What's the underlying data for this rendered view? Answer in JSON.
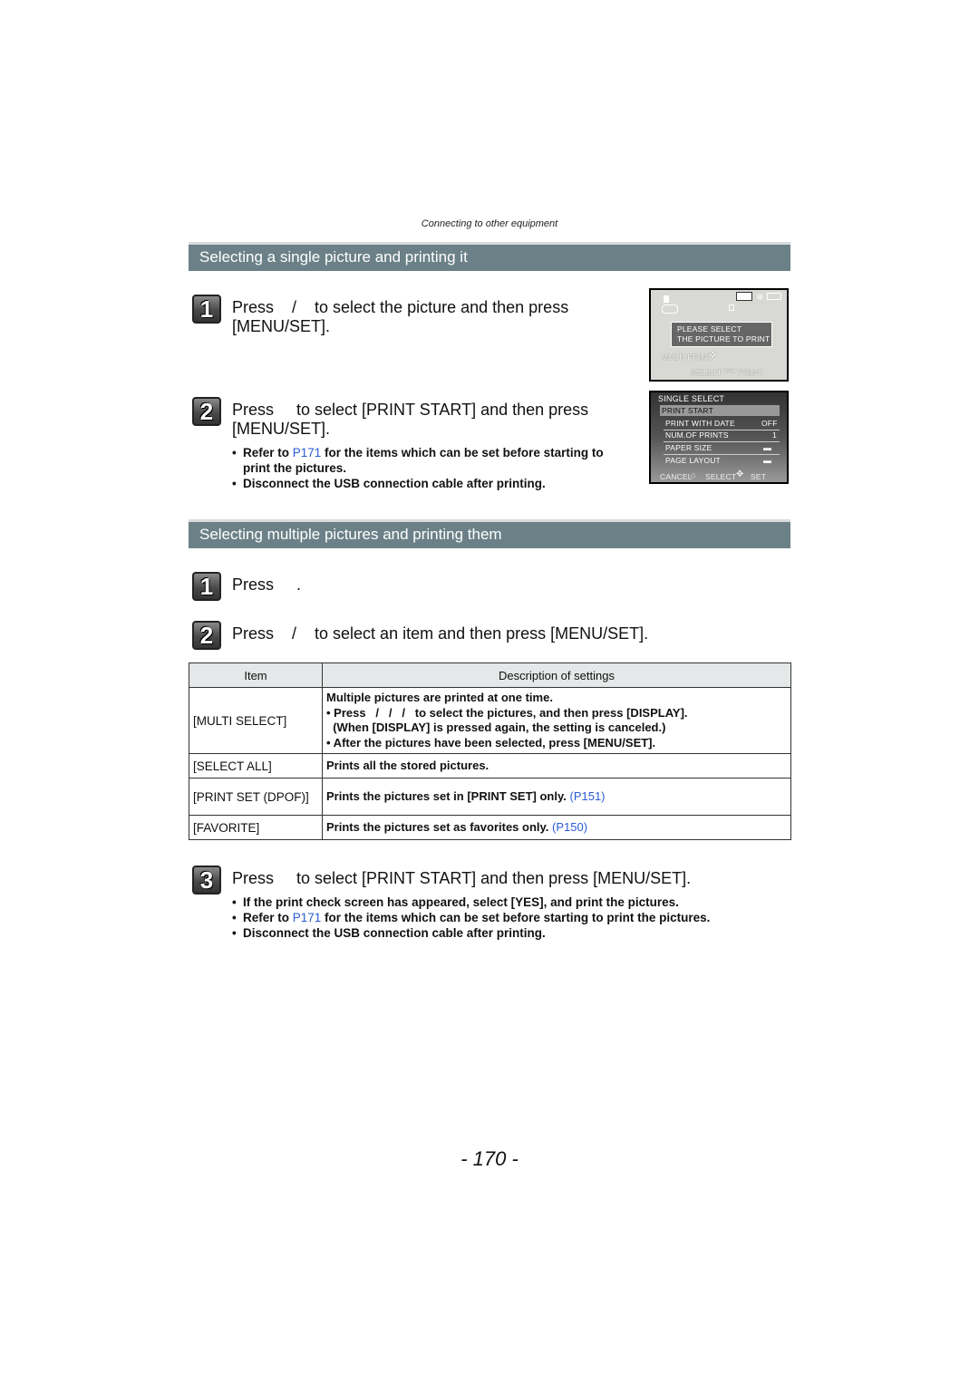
{
  "running_head": "Connecting to other equipment",
  "section1": {
    "title": "Selecting a single picture and printing it",
    "steps": [
      {
        "number": "1",
        "text_line1": "Press    /    to select the picture and then press",
        "text_line2": "[MENU/SET]."
      },
      {
        "number": "2",
        "text_line1": "Press     to select [PRINT START] and then press",
        "text_line2": "[MENU/SET].",
        "bullets": [
          {
            "pre": "Refer to ",
            "link": "P171",
            "post": " for the items which can be set before starting to",
            "cont": "print the pictures."
          },
          {
            "pre": "Disconnect the USB connection cable after printing."
          }
        ]
      }
    ],
    "screen1": {
      "message_line1": "PLEASE SELECT",
      "message_line2": "THE PICTURE TO PRINT",
      "multi_print": "MULTI PRINT",
      "select_label": "SELECT",
      "print_label": "PRINT"
    },
    "screen2": {
      "title": "SINGLE SELECT",
      "rows": [
        {
          "label": "PRINT START",
          "value": ""
        },
        {
          "label": "PRINT WITH DATE",
          "value": "OFF"
        },
        {
          "label": "NUM.OF PRINTS",
          "value": "1"
        },
        {
          "label": "PAPER SIZE",
          "value": "printer"
        },
        {
          "label": "PAGE LAYOUT",
          "value": "printer"
        }
      ],
      "footer_cancel": "CANCEL",
      "footer_select": "SELECT",
      "footer_set": "SET"
    }
  },
  "section2": {
    "title": "Selecting multiple pictures and printing them",
    "steps": [
      {
        "number": "1",
        "text": "Press     ."
      },
      {
        "number": "2",
        "text": "Press    /    to select an item and then press [MENU/SET]."
      },
      {
        "number": "3",
        "text": "Press     to select [PRINT START] and then press [MENU/SET].",
        "bullets": [
          {
            "pre": "If the print check screen has appeared, select [YES], and print the pictures."
          },
          {
            "pre": "Refer to ",
            "link": "P171",
            "post": " for the items which can be set before starting to print the pictures."
          },
          {
            "pre": "Disconnect the USB connection cable after printing."
          }
        ]
      }
    ],
    "table": {
      "headers": [
        "Item",
        "Description of settings"
      ],
      "rows": [
        {
          "item": "[MULTI SELECT]",
          "lines": [
            "Multiple pictures are printed at one time.",
            "• Press   /   /   /   to select the pictures, and then press [DISPLAY].",
            "  (When [DISPLAY] is pressed again, the setting is canceled.)",
            "• After the pictures have been selected, press [MENU/SET]."
          ]
        },
        {
          "item": "[SELECT ALL]",
          "lines": [
            "Prints all the stored pictures."
          ]
        },
        {
          "item": "[PRINT SET (DPOF)]",
          "lines": [
            "Prints the pictures set in [PRINT SET] only."
          ],
          "link": "(P151)"
        },
        {
          "item": "[FAVORITE]",
          "lines": [
            "Prints the pictures set as favorites only."
          ],
          "link": "(P150)"
        }
      ]
    }
  },
  "page_number": "- 170 -"
}
